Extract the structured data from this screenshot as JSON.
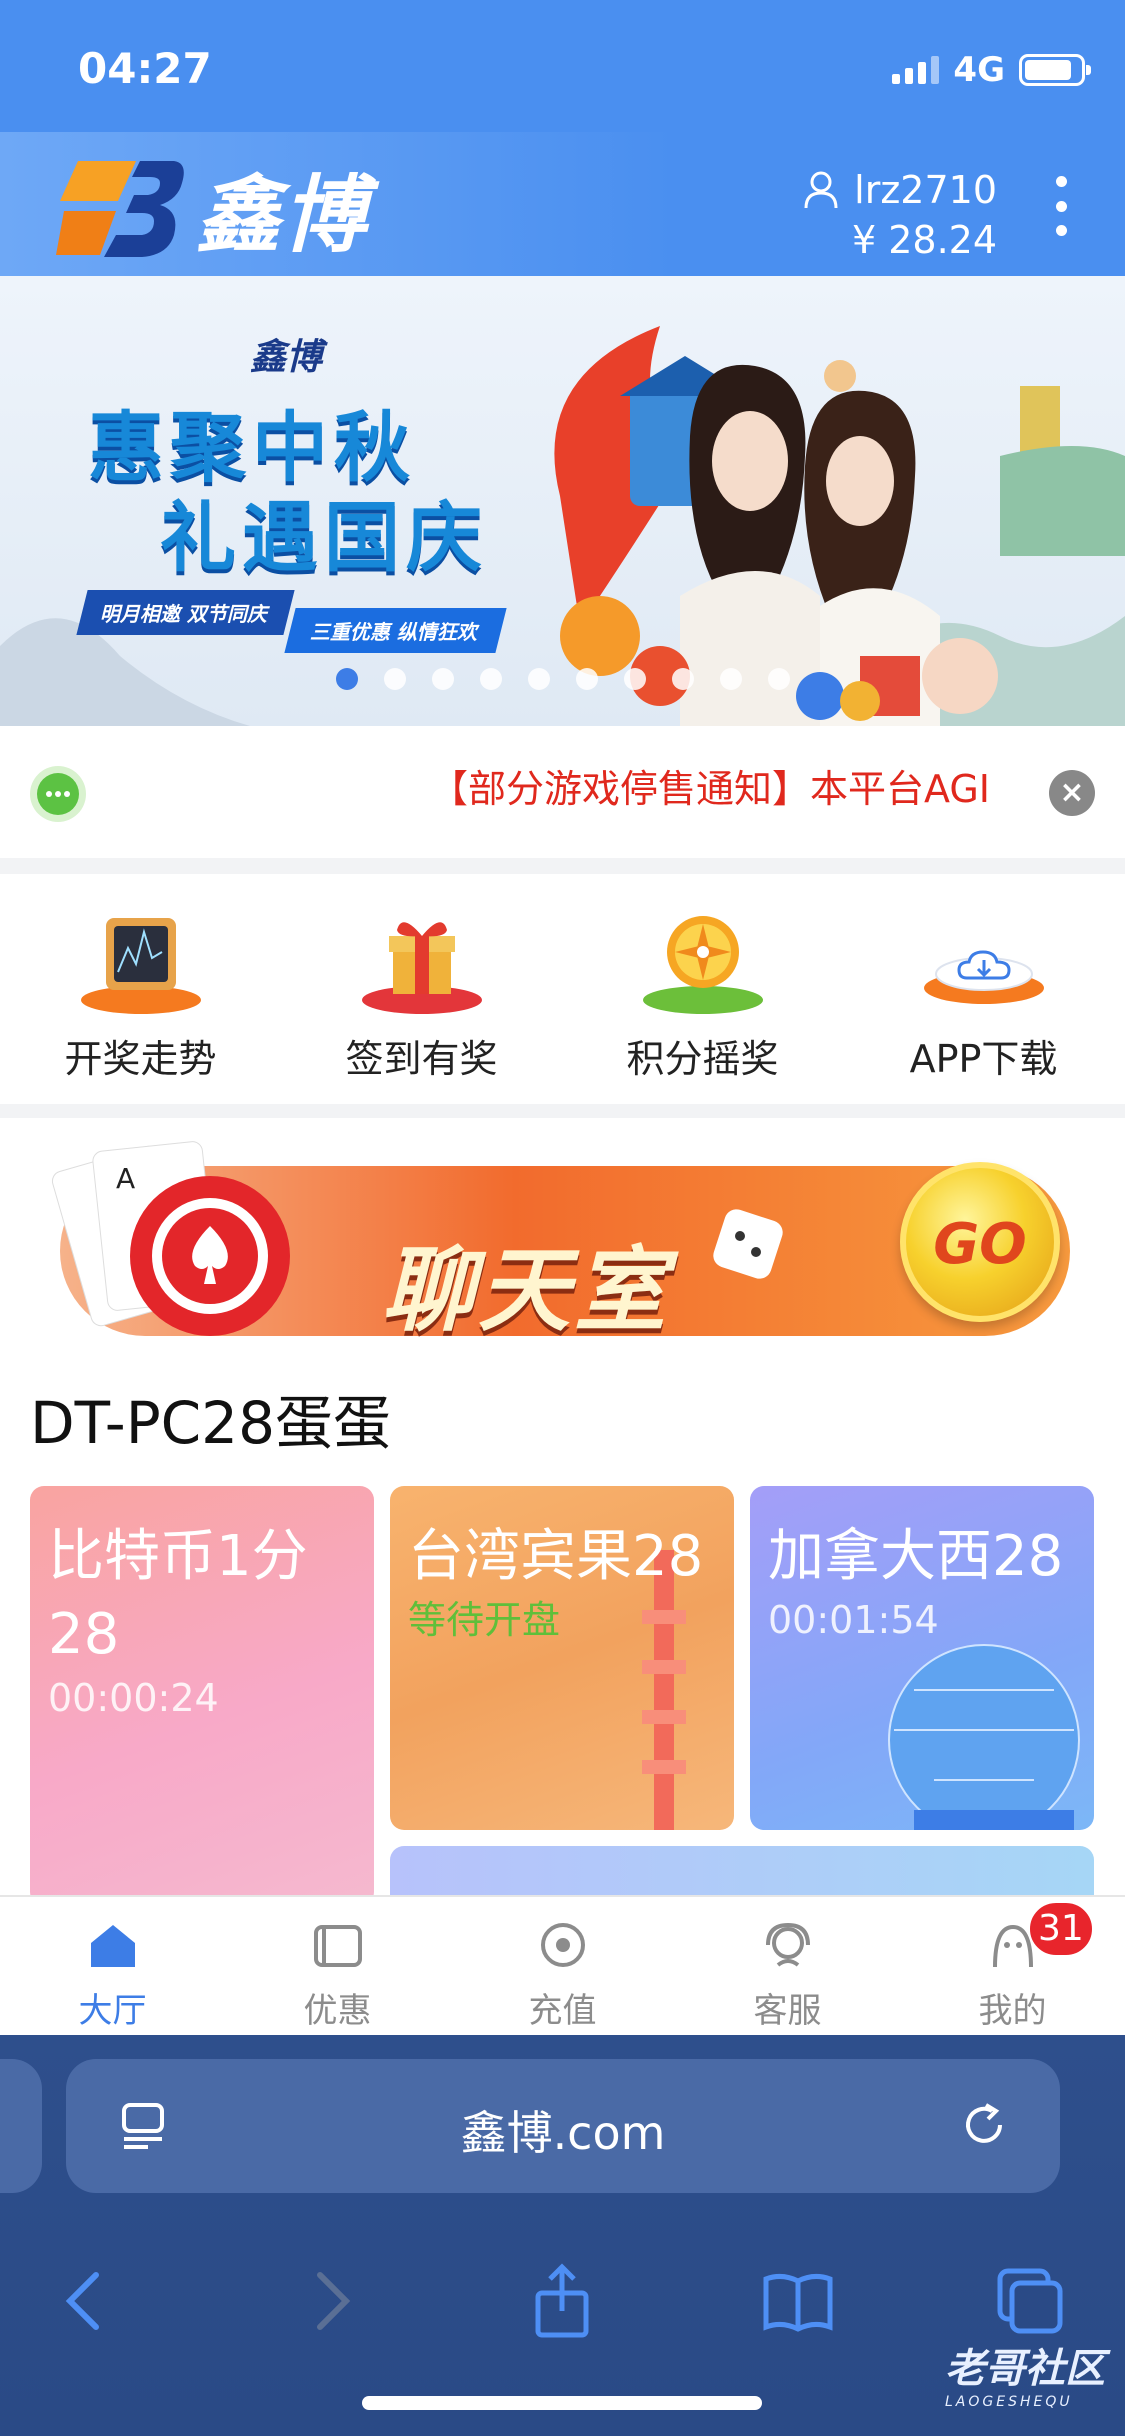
{
  "status_bar": {
    "time": "04:27",
    "network": "4G",
    "battery_level": 0.85
  },
  "header": {
    "logo_text": "鑫博",
    "username": "lrz2710",
    "balance": "¥ 28.24"
  },
  "banner": {
    "logo_text": "鑫博",
    "title_line1": "惠聚中秋",
    "title_line2": "礼遇国庆",
    "tag1": "明月相邀 双节同庆",
    "tag2": "三重优惠 纵情狂欢",
    "total_slides": 10,
    "active_slide": 1
  },
  "notice": {
    "text": "【部分游戏停售通知】本平台AGI"
  },
  "quick_menu": [
    {
      "label": "开奖走势",
      "icon": "trend-chart-icon"
    },
    {
      "label": "签到有奖",
      "icon": "gift-box-icon"
    },
    {
      "label": "积分摇奖",
      "icon": "prize-wheel-icon"
    },
    {
      "label": "APP下载",
      "icon": "cloud-download-icon"
    }
  ],
  "chat_banner": {
    "text": "聊天室",
    "button": "GO"
  },
  "section": {
    "title": "DT-PC28蛋蛋"
  },
  "games": [
    {
      "name": "比特币1分28",
      "name_line1": "比特币1分",
      "name_line2": "28",
      "timer": "00:00:24"
    },
    {
      "name": "台湾宾果28",
      "status": "等待开盘"
    },
    {
      "name": "加拿大西28",
      "timer": "00:01:54"
    }
  ],
  "tabbar": [
    {
      "label": "大厅",
      "icon": "home-icon",
      "active": true
    },
    {
      "label": "优惠",
      "icon": "coupon-icon",
      "active": false
    },
    {
      "label": "充值",
      "icon": "recharge-icon",
      "active": false
    },
    {
      "label": "客服",
      "icon": "customer-service-icon",
      "active": false
    },
    {
      "label": "我的",
      "icon": "profile-icon",
      "active": false,
      "badge": "31"
    }
  ],
  "browser": {
    "url": "鑫博.com"
  },
  "watermark": {
    "text": "老哥社区",
    "sub": "LAOGESHEQU"
  },
  "colors": {
    "brand_blue": "#4a8ff0",
    "notice_red": "#e0281d",
    "active_tab": "#3d7de6",
    "badge_red": "#e8252c",
    "status_green": "#5fbf3a"
  }
}
